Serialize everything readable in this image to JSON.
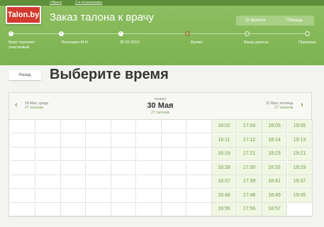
{
  "breadcrumb": [
    "г.Минск",
    "2-я поликлиника"
  ],
  "logo": "Talon.by",
  "page_title": "Заказ талона к врачу",
  "nav": [
    "О проекте",
    "Помощь"
  ],
  "steps": [
    {
      "label": "Врач-терапевт\nучастковый",
      "state": "done"
    },
    {
      "label": "Высоцкая М.Н.",
      "state": "done"
    },
    {
      "label": "30.05.2013",
      "state": "done"
    },
    {
      "label": "Время",
      "state": "current"
    },
    {
      "label": "Ваши данные",
      "state": "future"
    },
    {
      "label": "Проверка",
      "state": "future"
    }
  ],
  "back_label": "Назад",
  "heading": "Выберите время",
  "prev_day": {
    "label": "29 Мая, среда",
    "count": "27 талонов"
  },
  "current_day": {
    "weekday": "четверг",
    "date": "30 Мая",
    "count": "27 талонов"
  },
  "next_day": {
    "label": "31 Мая, пятница",
    "count": "27 талонов"
  },
  "slot_columns": [
    [],
    [],
    [],
    [],
    [],
    [],
    [],
    [],
    [
      "16:02",
      "16:11",
      "16:19",
      "16:28",
      "16:37",
      "16:46",
      "16:55"
    ],
    [
      "17:04",
      "17:12",
      "17:21",
      "17:30",
      "17:39",
      "17:48",
      "17:56"
    ],
    [
      "18:05",
      "18:14",
      "18:23",
      "18:32",
      "18:41",
      "18:49",
      "18:57"
    ],
    [
      "19:05",
      "19:13",
      "19:21",
      "19:29",
      "19:37",
      "19:45",
      ""
    ]
  ]
}
